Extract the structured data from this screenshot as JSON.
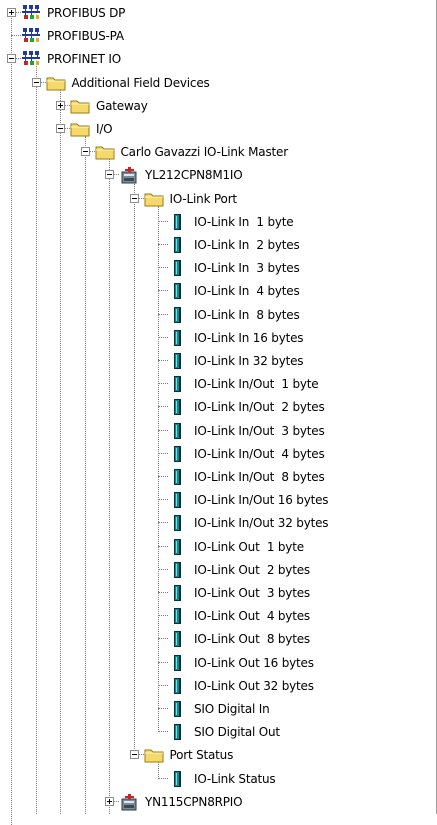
{
  "tree": {
    "nodes": [
      {
        "id": "profibus-dp",
        "label": "PROFIBUS DP",
        "icon": "network-icon",
        "depth": 0,
        "expander": "collapsed"
      },
      {
        "id": "profibus-pa",
        "label": "PROFIBUS-PA",
        "icon": "network-icon",
        "depth": 0,
        "expander": "none"
      },
      {
        "id": "profinet-io",
        "label": "PROFINET IO",
        "icon": "network-icon",
        "depth": 0,
        "expander": "expanded"
      },
      {
        "id": "additional-field-devices",
        "label": "Additional Field Devices",
        "icon": "folder-icon",
        "depth": 1,
        "expander": "expanded"
      },
      {
        "id": "gateway",
        "label": "Gateway",
        "icon": "folder-icon",
        "depth": 2,
        "expander": "collapsed"
      },
      {
        "id": "io-folder",
        "label": "I/O",
        "icon": "folder-icon",
        "depth": 2,
        "expander": "expanded"
      },
      {
        "id": "carlo-gavazzi-io-link-master",
        "label": "Carlo Gavazzi IO-Link Master",
        "icon": "folder-icon",
        "depth": 3,
        "expander": "expanded"
      },
      {
        "id": "yl212cpn8m1io",
        "label": "YL212CPN8M1IO",
        "icon": "device-icon",
        "depth": 4,
        "expander": "expanded"
      },
      {
        "id": "io-link-port",
        "label": "IO-Link Port",
        "icon": "folder-icon",
        "depth": 5,
        "expander": "expanded"
      },
      {
        "id": "io-link-in-1-byte",
        "label": "IO-Link In  1 byte",
        "icon": "module-icon",
        "depth": 6,
        "expander": "none"
      },
      {
        "id": "io-link-in-2-bytes",
        "label": "IO-Link In  2 bytes",
        "icon": "module-icon",
        "depth": 6,
        "expander": "none"
      },
      {
        "id": "io-link-in-3-bytes",
        "label": "IO-Link In  3 bytes",
        "icon": "module-icon",
        "depth": 6,
        "expander": "none"
      },
      {
        "id": "io-link-in-4-bytes",
        "label": "IO-Link In  4 bytes",
        "icon": "module-icon",
        "depth": 6,
        "expander": "none"
      },
      {
        "id": "io-link-in-8-bytes",
        "label": "IO-Link In  8 bytes",
        "icon": "module-icon",
        "depth": 6,
        "expander": "none"
      },
      {
        "id": "io-link-in-16-bytes",
        "label": "IO-Link In 16 bytes",
        "icon": "module-icon",
        "depth": 6,
        "expander": "none"
      },
      {
        "id": "io-link-in-32-bytes",
        "label": "IO-Link In 32 bytes",
        "icon": "module-icon",
        "depth": 6,
        "expander": "none"
      },
      {
        "id": "io-link-inout-1-byte",
        "label": "IO-Link In/Out  1 byte",
        "icon": "module-icon",
        "depth": 6,
        "expander": "none"
      },
      {
        "id": "io-link-inout-2-bytes",
        "label": "IO-Link In/Out  2 bytes",
        "icon": "module-icon",
        "depth": 6,
        "expander": "none"
      },
      {
        "id": "io-link-inout-3-bytes",
        "label": "IO-Link In/Out  3 bytes",
        "icon": "module-icon",
        "depth": 6,
        "expander": "none"
      },
      {
        "id": "io-link-inout-4-bytes",
        "label": "IO-Link In/Out  4 bytes",
        "icon": "module-icon",
        "depth": 6,
        "expander": "none"
      },
      {
        "id": "io-link-inout-8-bytes",
        "label": "IO-Link In/Out  8 bytes",
        "icon": "module-icon",
        "depth": 6,
        "expander": "none"
      },
      {
        "id": "io-link-inout-16-bytes",
        "label": "IO-Link In/Out 16 bytes",
        "icon": "module-icon",
        "depth": 6,
        "expander": "none"
      },
      {
        "id": "io-link-inout-32-bytes",
        "label": "IO-Link In/Out 32 bytes",
        "icon": "module-icon",
        "depth": 6,
        "expander": "none"
      },
      {
        "id": "io-link-out-1-byte",
        "label": "IO-Link Out  1 byte",
        "icon": "module-icon",
        "depth": 6,
        "expander": "none"
      },
      {
        "id": "io-link-out-2-bytes",
        "label": "IO-Link Out  2 bytes",
        "icon": "module-icon",
        "depth": 6,
        "expander": "none"
      },
      {
        "id": "io-link-out-3-bytes",
        "label": "IO-Link Out  3 bytes",
        "icon": "module-icon",
        "depth": 6,
        "expander": "none"
      },
      {
        "id": "io-link-out-4-bytes",
        "label": "IO-Link Out  4 bytes",
        "icon": "module-icon",
        "depth": 6,
        "expander": "none"
      },
      {
        "id": "io-link-out-8-bytes",
        "label": "IO-Link Out  8 bytes",
        "icon": "module-icon",
        "depth": 6,
        "expander": "none"
      },
      {
        "id": "io-link-out-16-bytes",
        "label": "IO-Link Out 16 bytes",
        "icon": "module-icon",
        "depth": 6,
        "expander": "none"
      },
      {
        "id": "io-link-out-32-bytes",
        "label": "IO-Link Out 32 bytes",
        "icon": "module-icon",
        "depth": 6,
        "expander": "none"
      },
      {
        "id": "sio-digital-in",
        "label": "SIO Digital In",
        "icon": "module-icon",
        "depth": 6,
        "expander": "none"
      },
      {
        "id": "sio-digital-out",
        "label": "SIO Digital Out",
        "icon": "module-icon",
        "depth": 6,
        "expander": "none"
      },
      {
        "id": "port-status",
        "label": "Port Status",
        "icon": "folder-icon",
        "depth": 5,
        "expander": "expanded"
      },
      {
        "id": "io-link-status",
        "label": "IO-Link Status",
        "icon": "module-icon",
        "depth": 6,
        "expander": "none"
      },
      {
        "id": "yn115cpn8rpio",
        "label": "YN115CPN8RPIO",
        "icon": "device-icon",
        "depth": 4,
        "expander": "collapsed"
      }
    ]
  },
  "colors": {
    "folder_fill": "#f5d96b",
    "folder_stroke": "#9a7a10",
    "network_node": "#1f3a9e",
    "module_teal": "#0b8c8c",
    "module_dark": "#0b2f40",
    "device_gray": "#7a8d9a",
    "device_red": "#cc2222"
  }
}
